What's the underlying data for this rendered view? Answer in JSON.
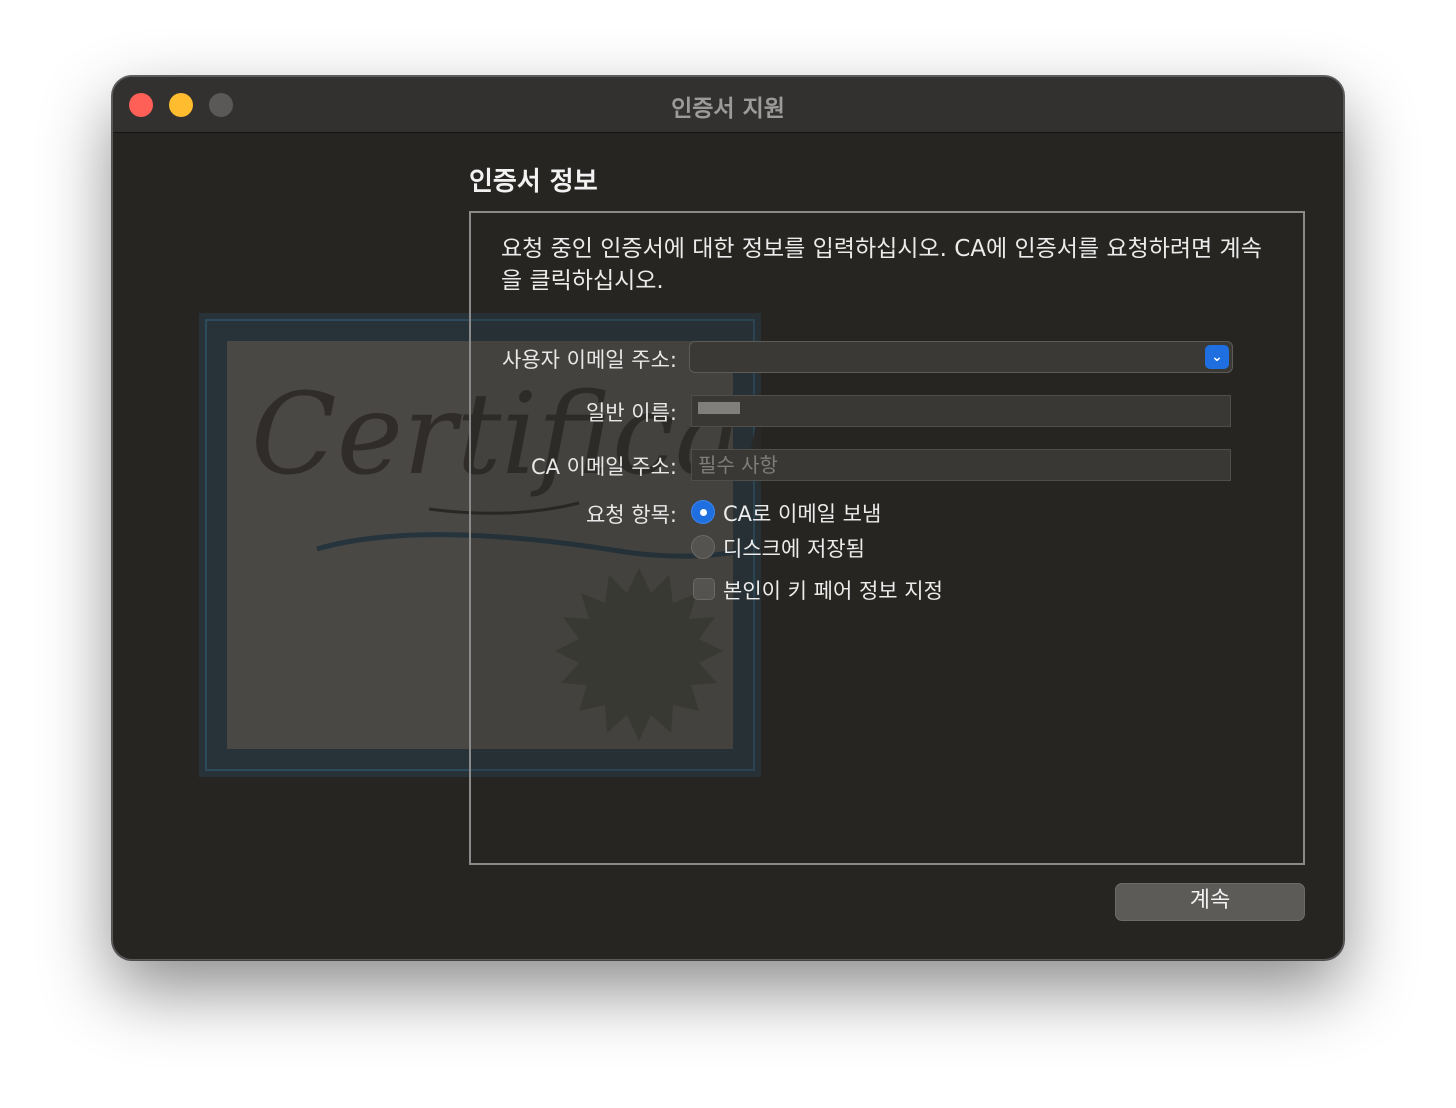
{
  "window": {
    "title": "인증서 지원"
  },
  "section": {
    "title": "인증서 정보"
  },
  "instructions": "요청 중인 인증서에 대한 정보를 입력하십시오. CA에 인증서를 요청하려면 계속을 클릭하십시오.",
  "artwork": {
    "script_text": "Certificate"
  },
  "form": {
    "user_email_label": "사용자 이메일 주소:",
    "user_email_value": "",
    "common_name_label": "일반 이름:",
    "ca_email_label": "CA 이메일 주소:",
    "ca_email_placeholder": "필수 사항",
    "request_label": "요청 항목:",
    "options": [
      {
        "label": "CA로 이메일 보냄",
        "selected": true
      },
      {
        "label": "디스크에 저장됨",
        "selected": false
      }
    ],
    "keypair_label": "본인이 키 페어 정보 지정",
    "keypair_checked": false
  },
  "buttons": {
    "continue_label": "계속"
  },
  "icons": {
    "combo_arrow": "chevron-down-icon"
  },
  "colors": {
    "accent": "#1f6fe0",
    "close": "#fe5f57",
    "minimize": "#febc2e"
  }
}
